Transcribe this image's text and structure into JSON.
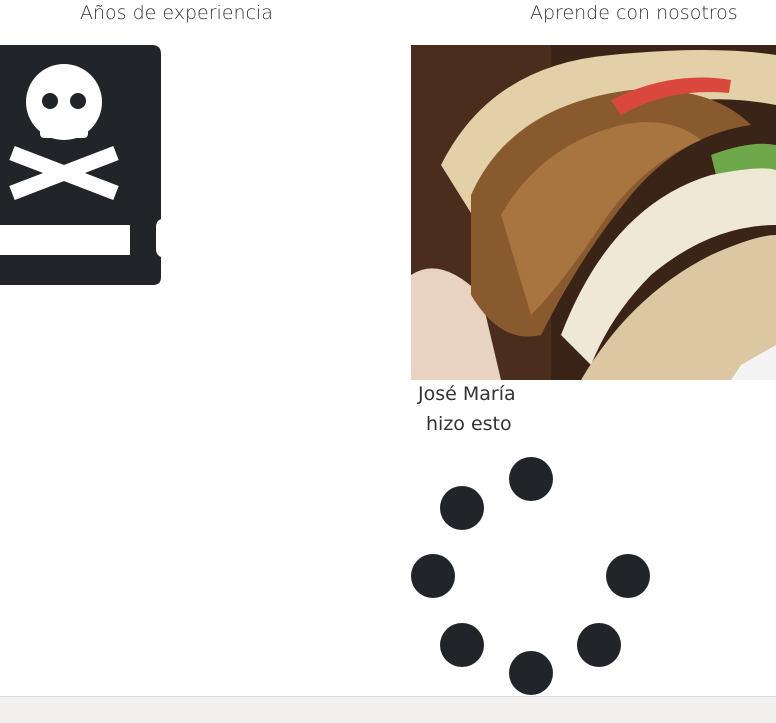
{
  "headings": {
    "left": "Años de experiencia",
    "right": "Aprende con nosotros"
  },
  "icons": {
    "book": "skull-book-icon",
    "spinner": "loading-spinner-icon"
  },
  "photo": {
    "subject": "kebab-sandwich-photo"
  },
  "caption": {
    "name": "José María",
    "action": "hizo esto"
  },
  "colors": {
    "icon": "#212428",
    "text": "#333333",
    "footer": "#f1f0ef"
  }
}
